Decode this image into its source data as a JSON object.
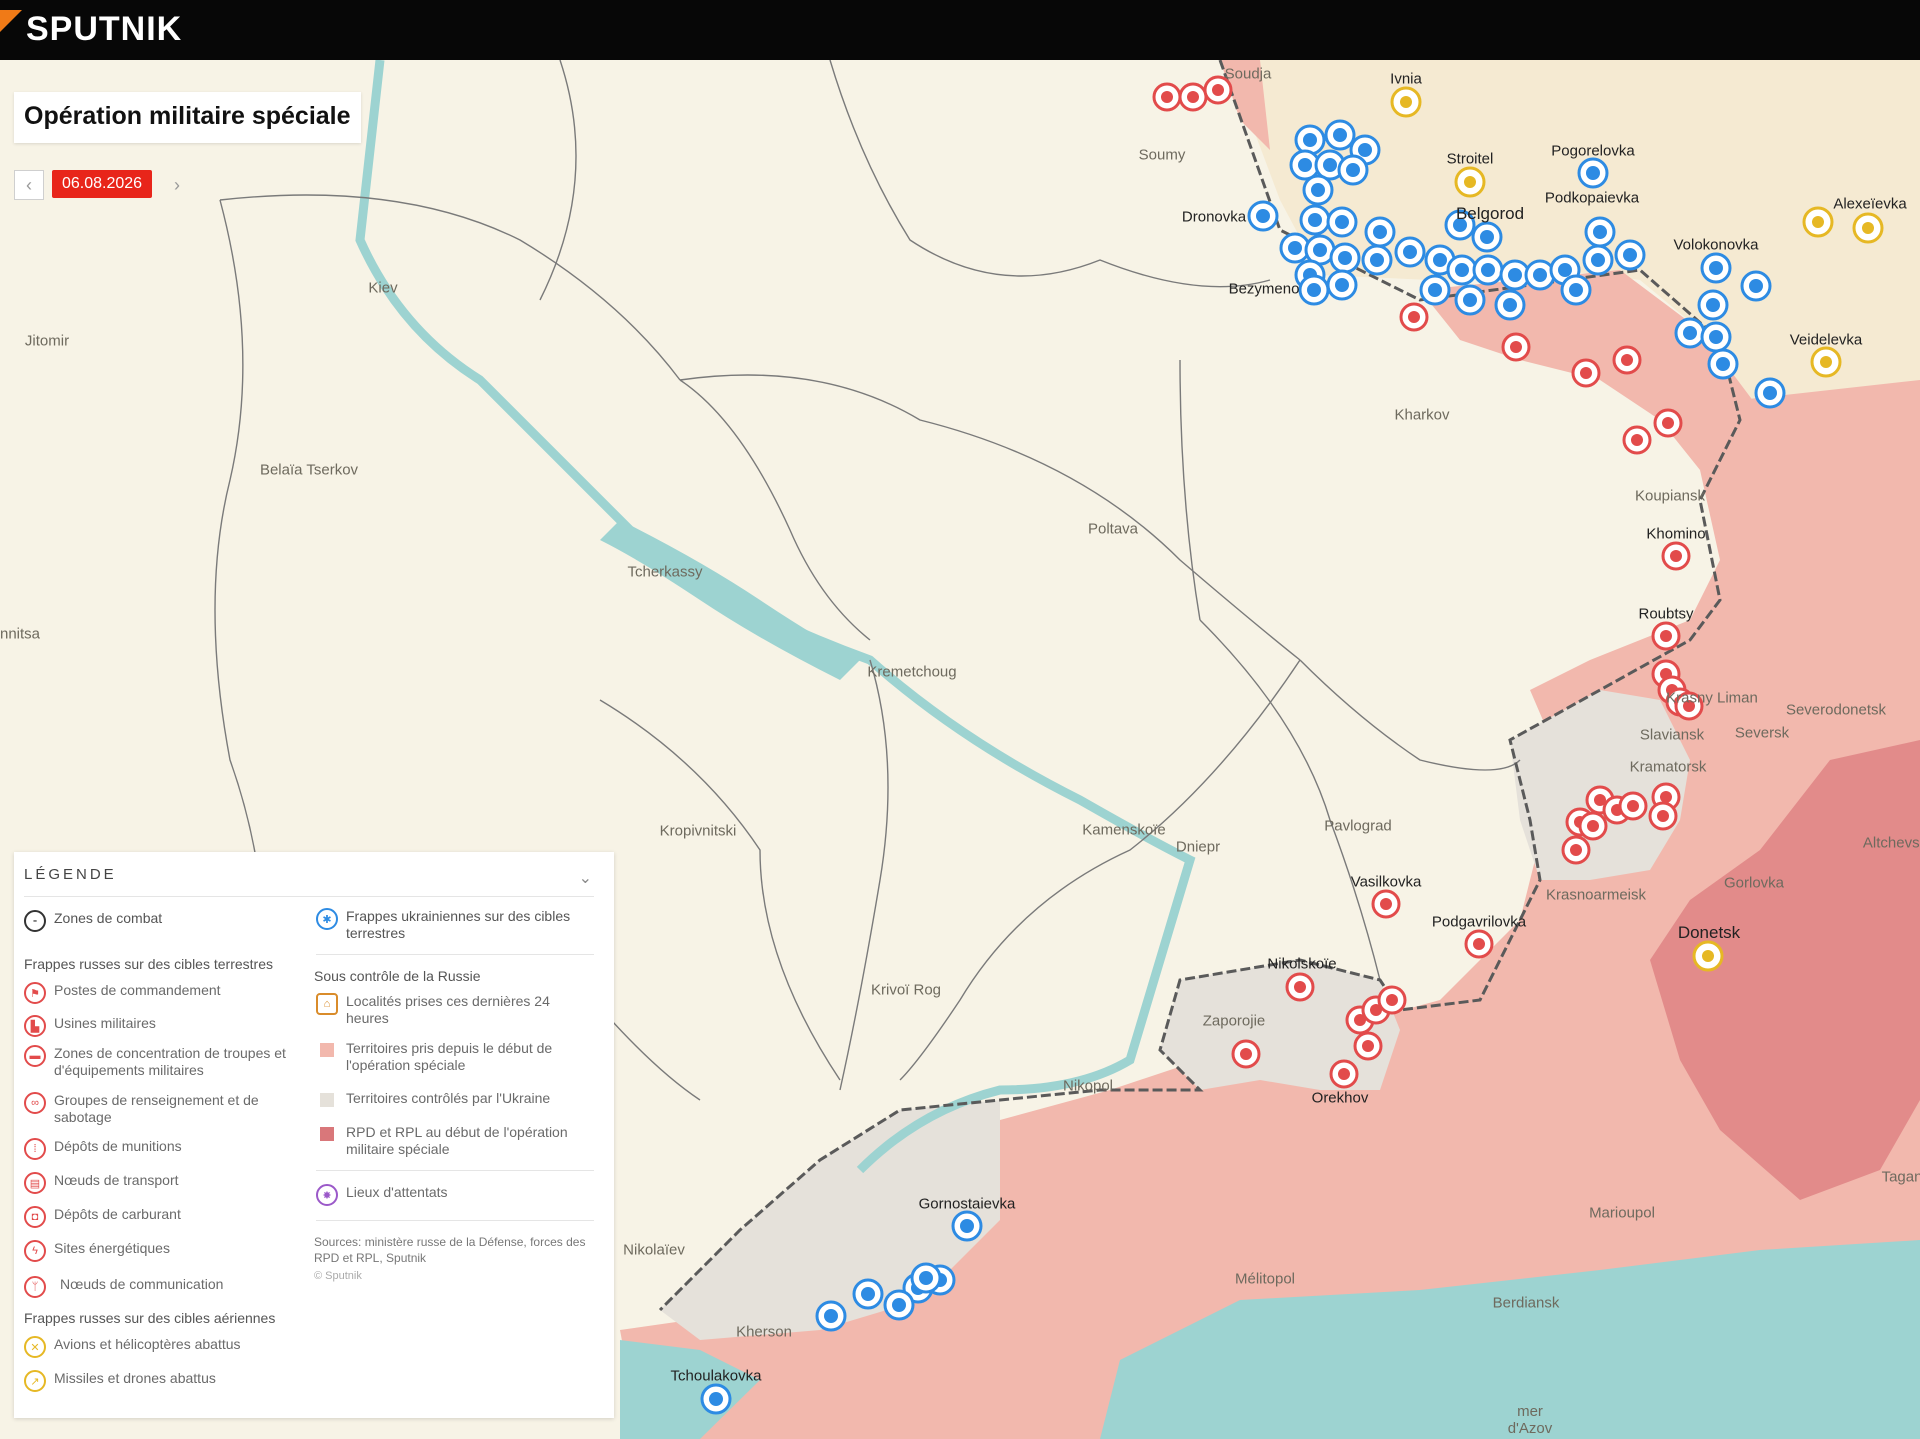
{
  "header": {
    "brand": "SPUTNIK"
  },
  "title": "Opération militaire spéciale",
  "date": {
    "current": "06.08.2026",
    "prev_icon": "chevron-left-icon",
    "next_icon": "chevron-right-icon"
  },
  "colors": {
    "russian_control": "#f2b8ad",
    "dpr_lpr": "#e79a98",
    "ukraine_control": "#e5e1da",
    "water": "#9dd3d1",
    "land": "#f7f3e6",
    "red_marker": "#e24b4b",
    "blue_marker": "#2d8be3",
    "yellow_marker": "#e6b824"
  },
  "places": [
    {
      "id": "soudja",
      "name": "Soudja"
    },
    {
      "id": "ivnia",
      "name": "Ivnia"
    },
    {
      "id": "soumy",
      "name": "Soumy"
    },
    {
      "id": "stroitel",
      "name": "Stroitel"
    },
    {
      "id": "pogorelovka",
      "name": "Pogorelovka"
    },
    {
      "id": "podkopaievka",
      "name": "Podkopaievka"
    },
    {
      "id": "alexeievka",
      "name": "Alexeïevka"
    },
    {
      "id": "dronovka",
      "name": "Dronovka"
    },
    {
      "id": "belgorod",
      "name": "Belgorod"
    },
    {
      "id": "volokonovka",
      "name": "Volokonovka"
    },
    {
      "id": "bezymeno",
      "name": "Bezymeno"
    },
    {
      "id": "veidelevka",
      "name": "Veidelevka"
    },
    {
      "id": "kiev",
      "name": "Kiev"
    },
    {
      "id": "jitomir",
      "name": "Jitomir"
    },
    {
      "id": "kharkov",
      "name": "Kharkov"
    },
    {
      "id": "belaia",
      "name": "Belaïa Tserkov"
    },
    {
      "id": "koupiansk",
      "name": "Koupiansk"
    },
    {
      "id": "poltava",
      "name": "Poltava"
    },
    {
      "id": "khomino",
      "name": "Khomino"
    },
    {
      "id": "tcherkassy",
      "name": "Tcherkassy"
    },
    {
      "id": "vinnitsa",
      "name": "nnitsa"
    },
    {
      "id": "roubtsy",
      "name": "Roubtsy"
    },
    {
      "id": "krasny",
      "name": "Krasny Liman"
    },
    {
      "id": "kremetchoug",
      "name": "Kremetchoug"
    },
    {
      "id": "severodonetsk",
      "name": "Severodonetsk"
    },
    {
      "id": "slaviansk",
      "name": "Slaviansk"
    },
    {
      "id": "seversk",
      "name": "Seversk"
    },
    {
      "id": "kramatorsk",
      "name": "Kramatorsk"
    },
    {
      "id": "pavlograd",
      "name": "Pavlograd"
    },
    {
      "id": "kropivnitski",
      "name": "Kropivnitski"
    },
    {
      "id": "kamenskoie",
      "name": "Kamenskoïe"
    },
    {
      "id": "dniepr",
      "name": "Dniepr"
    },
    {
      "id": "altchevsk",
      "name": "Altchevsk"
    },
    {
      "id": "vasilkovka",
      "name": "Vasilkovka"
    },
    {
      "id": "gorlovka",
      "name": "Gorlovka"
    },
    {
      "id": "krasnoarmeisk",
      "name": "Krasnoarmeisk"
    },
    {
      "id": "podgavrilovka",
      "name": "Podgavrilovka"
    },
    {
      "id": "donetsk",
      "name": "Donetsk"
    },
    {
      "id": "nikolskoie",
      "name": "Nikolskoïe"
    },
    {
      "id": "krivoi",
      "name": "Krivoï Rog"
    },
    {
      "id": "zaporojie",
      "name": "Zaporojie"
    },
    {
      "id": "nikopol",
      "name": "Nikopol"
    },
    {
      "id": "orekhov",
      "name": "Orekhov"
    },
    {
      "id": "gornostaievka",
      "name": "Gornostaievka"
    },
    {
      "id": "taganrog",
      "name": "Tagan"
    },
    {
      "id": "marioupol",
      "name": "Marioupol"
    },
    {
      "id": "nikolaiev",
      "name": "Nikolaïev"
    },
    {
      "id": "melitopol",
      "name": "Mélitopol"
    },
    {
      "id": "kherson",
      "name": "Kherson"
    },
    {
      "id": "berdiansk",
      "name": "Berdiansk"
    },
    {
      "id": "tchoulakovka",
      "name": "Tchoulakovka"
    },
    {
      "id": "mer",
      "name": "mer d'Azov"
    }
  ],
  "legend": {
    "heading": "LÉGENDE",
    "combat": "Zones de combat",
    "russian_ground_heading": "Frappes russes sur des cibles terrestres",
    "russian_ground": [
      {
        "label": "Postes de commandement",
        "icon": "flag-icon"
      },
      {
        "label": "Usines militaires",
        "icon": "factory-icon"
      },
      {
        "label": "Zones de concentration de troupes et d'équipements militaires",
        "icon": "truck-icon"
      },
      {
        "label": "Groupes de renseignement et de sabotage",
        "icon": "binoculars-icon"
      },
      {
        "label": "Dépôts de munitions",
        "icon": "ammo-icon"
      },
      {
        "label": "Nœuds de transport",
        "icon": "train-icon"
      },
      {
        "label": "Dépôts de carburant",
        "icon": "fuel-icon"
      },
      {
        "label": "Sites énergétiques",
        "icon": "lightning-icon"
      },
      {
        "label": "Nœuds de communication",
        "icon": "antenna-icon"
      }
    ],
    "russian_air_heading": "Frappes russes sur des cibles aériennes",
    "russian_air": [
      {
        "label": "Avions et hélicoptères abattus",
        "icon": "aircraft-icon"
      },
      {
        "label": "Missiles et drones abattus",
        "icon": "missile-icon"
      }
    ],
    "ukrainian_strikes": "Frappes ukrainiennes sur des cibles terrestres",
    "russia_control_heading": "Sous contrôle de la Russie",
    "control": [
      {
        "label": "Localités prises ces dernières 24 heures",
        "icon": "town-icon"
      },
      {
        "label": "Territoires pris depuis le début de l'opération spéciale",
        "color": "#f2b8ad"
      },
      {
        "label": "Territoires contrôlés par l'Ukraine",
        "color": "#e5e1da"
      },
      {
        "label": "RPD et RPL au début de l'opération militaire spéciale",
        "color": "#d9777a"
      }
    ],
    "attacks": "Lieux d'attentats",
    "sources": "Sources: ministère russe de la Défense, forces des RPD et RPL, Sputnik",
    "copyright": "© Sputnik"
  }
}
